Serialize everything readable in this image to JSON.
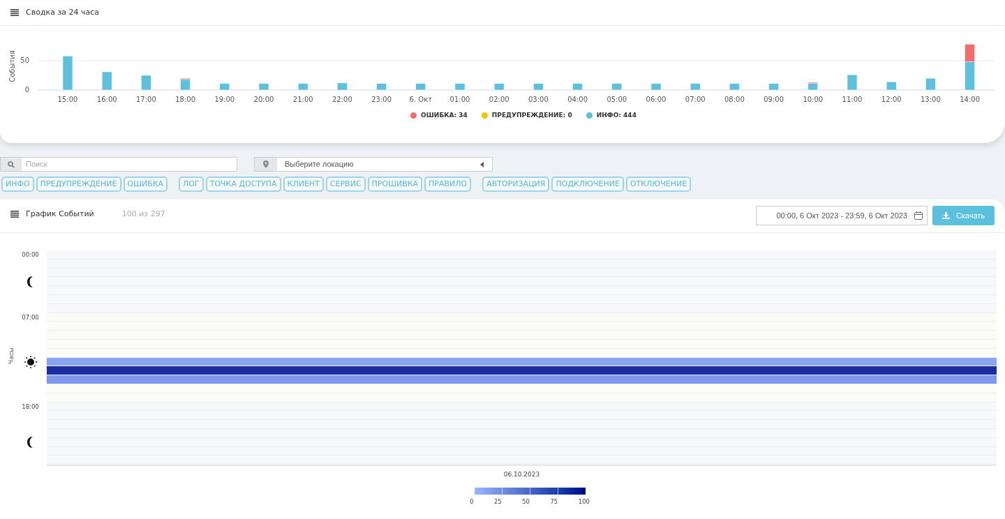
{
  "summary": {
    "title": "Сводка за 24 часа",
    "chart_data": {
      "type": "bar",
      "ylabel": "События",
      "stacked": true,
      "yticks": [
        0,
        50
      ],
      "ylim": [
        0,
        100
      ],
      "categories": [
        "15:00",
        "16:00",
        "17:00",
        "18:00",
        "19:00",
        "20:00",
        "21:00",
        "22:00",
        "23:00",
        "6. Окт",
        "01:00",
        "02:00",
        "03:00",
        "04:00",
        "05:00",
        "06:00",
        "07:00",
        "08:00",
        "09:00",
        "10:00",
        "11:00",
        "12:00",
        "13:00",
        "14:00"
      ],
      "series": [
        {
          "color": "#f46b6b",
          "values": [
            0,
            0,
            0,
            2,
            0,
            0,
            0,
            0,
            0,
            0,
            0,
            0,
            0,
            0,
            0,
            0,
            0,
            0,
            0,
            2,
            0,
            0,
            0,
            30
          ]
        },
        {
          "color": "#f5c400",
          "values": [
            0,
            0,
            0,
            0,
            0,
            0,
            0,
            0,
            0,
            0,
            0,
            0,
            0,
            0,
            0,
            0,
            0,
            0,
            0,
            0,
            0,
            0,
            0,
            0
          ]
        },
        {
          "color": "#5fc0dd",
          "values": [
            58,
            31,
            25,
            18,
            11,
            11,
            11,
            12,
            11,
            11,
            11,
            11,
            11,
            11,
            11,
            11,
            11,
            11,
            11,
            11,
            26,
            14,
            20,
            48
          ]
        }
      ]
    },
    "legend": [
      "ОШИБКА: 34",
      "ПРЕДУПРЕЖДЕНИЕ: 0",
      "ИНФО: 444"
    ]
  },
  "search": {
    "placeholder": "Поиск"
  },
  "location": {
    "text": "Выберите локацию"
  },
  "filter_groups": [
    [
      "ИНФО",
      "ПРЕДУПРЕЖДЕНИЕ",
      "ОШИБКА"
    ],
    [
      "ЛОГ",
      "ТОЧКА ДОСТУПА",
      "КЛИЕНТ",
      "СЕРВИС",
      "ПРОШИВКА",
      "ПРАВИЛО"
    ],
    [
      "АВТОРИЗАЦИЯ",
      "ПОДКЛЮЧЕНИЕ",
      "ОТКЛЮЧЕНИЕ"
    ]
  ],
  "events": {
    "title": "График Событий",
    "count": "100 из 297",
    "date_range": "00:00, 6 Окт 2023 - 23:59, 6 Окт 2023",
    "download": "Скачать",
    "heatmap": {
      "ylabel": "Часы",
      "xlabel": "06.10.2023",
      "scale": [
        "0",
        "25",
        "50",
        "75",
        "100"
      ],
      "hours": [
        {
          "label": "00:00",
          "kind": "night"
        },
        {
          "kind": "night"
        },
        {
          "kind": "night"
        },
        {
          "kind": "night"
        },
        {
          "kind": "night"
        },
        {
          "kind": "night"
        },
        {
          "kind": "night"
        },
        {
          "label": "07:00",
          "kind": "day"
        },
        {
          "kind": "day"
        },
        {
          "kind": "day"
        },
        {
          "kind": "day"
        },
        {
          "kind": "day"
        },
        {
          "color": "#8aa4f4"
        },
        {
          "color": "#1b2ca0"
        },
        {
          "color": "#7f98ee"
        },
        {
          "kind": "day"
        },
        {
          "kind": "day"
        },
        {
          "label": "18:00",
          "kind": "night"
        },
        {
          "kind": "night"
        },
        {
          "kind": "night"
        },
        {
          "kind": "night"
        },
        {
          "kind": "night"
        },
        {
          "kind": "night"
        },
        {
          "kind": "night"
        }
      ]
    }
  }
}
